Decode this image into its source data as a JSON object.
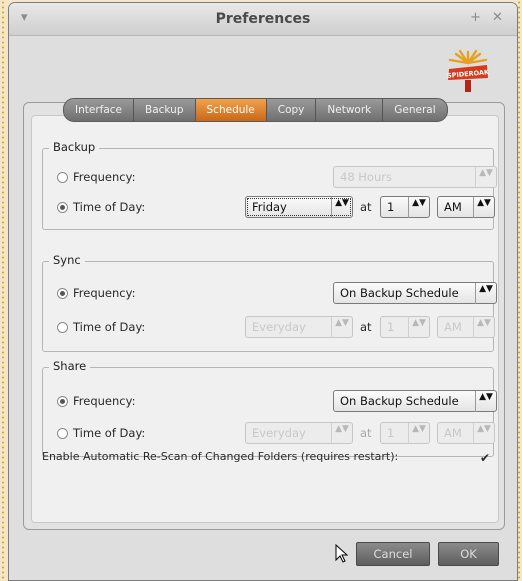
{
  "window": {
    "title": "Preferences",
    "menu_glyph": "▾",
    "pin_glyph": "+",
    "close_glyph": "✕"
  },
  "logo": {
    "text": "SPIDEROAK",
    "icon": "spideroak-logo"
  },
  "tabs": [
    {
      "label": "Interface",
      "active": false
    },
    {
      "label": "Backup",
      "active": false
    },
    {
      "label": "Schedule",
      "active": true
    },
    {
      "label": "Copy",
      "active": false
    },
    {
      "label": "Network",
      "active": false
    },
    {
      "label": "General",
      "active": false
    }
  ],
  "backup": {
    "title": "Backup",
    "frequency_label": "Frequency:",
    "frequency_value": "48 Hours",
    "timeofday_label": "Time of Day:",
    "day_value": "Friday",
    "at_label": "at",
    "hour_value": "1",
    "ampm_value": "AM"
  },
  "sync": {
    "title": "Sync",
    "frequency_label": "Frequency:",
    "frequency_value": "On Backup Schedule",
    "timeofday_label": "Time of Day:",
    "day_value": "Everyday",
    "at_label": "at",
    "hour_value": "1",
    "ampm_value": "AM"
  },
  "share": {
    "title": "Share",
    "frequency_label": "Frequency:",
    "frequency_value": "On Backup Schedule",
    "timeofday_label": "Time of Day:",
    "day_value": "Everyday",
    "at_label": "at",
    "hour_value": "1",
    "ampm_value": "AM"
  },
  "rescan": {
    "label": "Enable Automatic Re-Scan of Changed Folders (requires restart):",
    "checkmark": "✔"
  },
  "buttons": {
    "cancel": "Cancel",
    "ok": "OK"
  },
  "arrow_glyph": "▲▼"
}
